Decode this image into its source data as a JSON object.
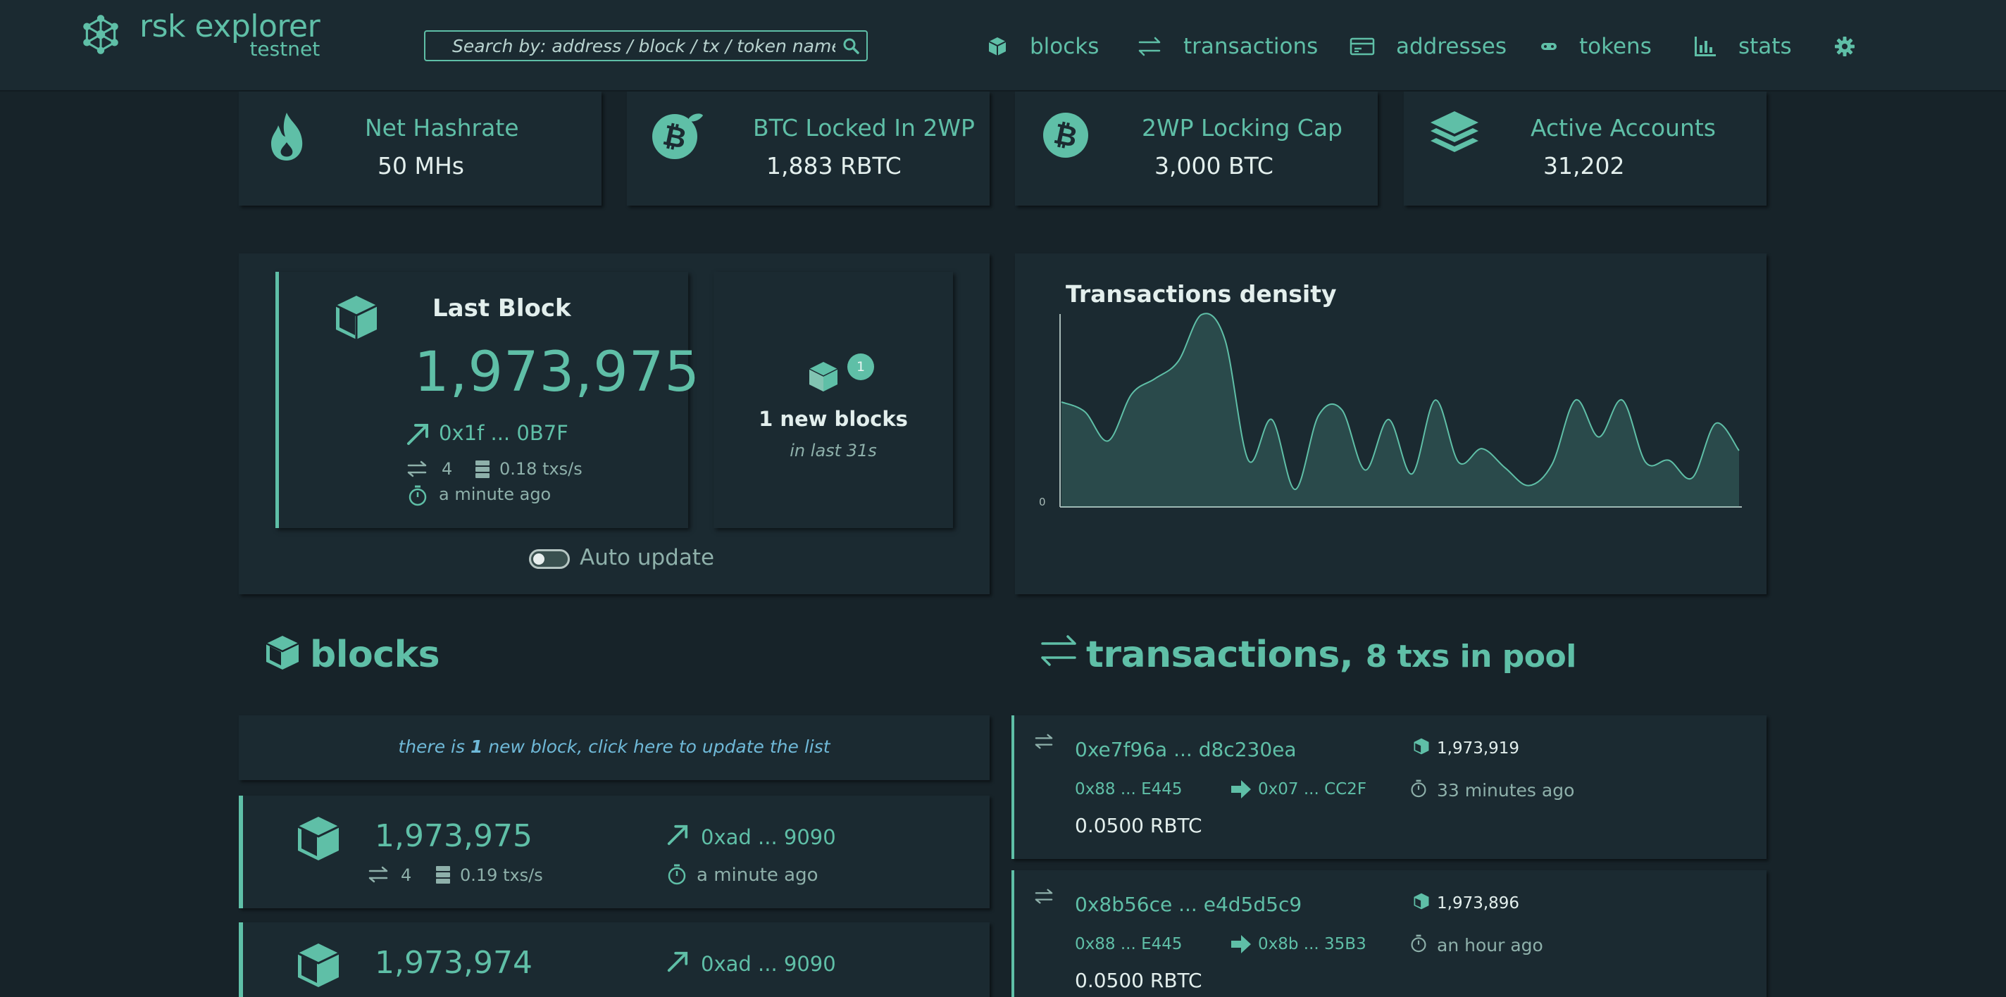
{
  "header": {
    "logo_title": "rsk explorer",
    "logo_subtitle": "testnet",
    "search_placeholder": "Search by: address / block / tx / token name",
    "nav": [
      {
        "label": "blocks",
        "icon": "cube-icon"
      },
      {
        "label": "transactions",
        "icon": "exchange-icon"
      },
      {
        "label": "addresses",
        "icon": "card-icon"
      },
      {
        "label": "tokens",
        "icon": "token-icon"
      },
      {
        "label": "stats",
        "icon": "bar-chart-icon"
      }
    ],
    "settings_icon": "gear-icon"
  },
  "stats": [
    {
      "title": "Net Hashrate",
      "value": "50 MHs",
      "icon": "fire-icon"
    },
    {
      "title": "BTC Locked In 2WP",
      "value": "1,883 RBTC",
      "icon": "bitcoin-leaf-icon"
    },
    {
      "title": "2WP Locking Cap",
      "value": "3,000 BTC",
      "icon": "bitcoin-icon"
    },
    {
      "title": "Active Accounts",
      "value": "31,202",
      "icon": "layers-icon"
    }
  ],
  "last_block": {
    "title": "Last Block",
    "number": "1,973,975",
    "miner": "0x1f ... 0B7F",
    "txs": "4",
    "tx_rate": "0.18 txs/s",
    "time": "a minute ago"
  },
  "new_blocks": {
    "badge": "1",
    "label": "1 new blocks",
    "sub": "in last 31s"
  },
  "auto_update": {
    "label": "Auto update",
    "enabled": false
  },
  "density": {
    "title": "Transactions density",
    "y_tick": "0"
  },
  "chart_data": {
    "type": "area",
    "title": "Transactions density",
    "y_tick_labels": [
      "0"
    ],
    "color": "#5fbfa7",
    "values": [
      5.4,
      4.9,
      3.4,
      5.8,
      6.6,
      7.5,
      9.9,
      8.6,
      2.4,
      4.5,
      0.9,
      4.7,
      5.0,
      1.9,
      4.5,
      1.7,
      5.5,
      2.3,
      3.0,
      2.0,
      1.1,
      2.2,
      5.5,
      3.6,
      5.5,
      2.3,
      2.4,
      1.5,
      4.3,
      2.9
    ]
  },
  "blocks_section": {
    "title": "blocks",
    "notice_pre": "there is ",
    "notice_count": "1",
    "notice_post": " new block, click here to update the list",
    "rows": [
      {
        "number": "1,973,975",
        "miner": "0xad ... 9090",
        "txs": "4",
        "tx_rate": "0.19 txs/s",
        "time": "a minute ago"
      },
      {
        "number": "1,973,974",
        "miner": "0xad ... 9090",
        "txs": "",
        "tx_rate": "",
        "time": ""
      }
    ]
  },
  "tx_section": {
    "title": "transactions,",
    "pool": "8 txs in pool",
    "rows": [
      {
        "hash": "0xe7f96a ... d8c230ea",
        "block": "1,973,919",
        "from": "0x88 ... E445",
        "to": "0x07 ... CC2F",
        "time": "33 minutes ago",
        "value": "0.0500 RBTC"
      },
      {
        "hash": "0x8b56ce ... e4d5d5c9",
        "block": "1,973,896",
        "from": "0x88 ... E445",
        "to": "0x8b ... 35B3",
        "time": "an hour ago",
        "value": "0.0500 RBTC"
      }
    ]
  }
}
